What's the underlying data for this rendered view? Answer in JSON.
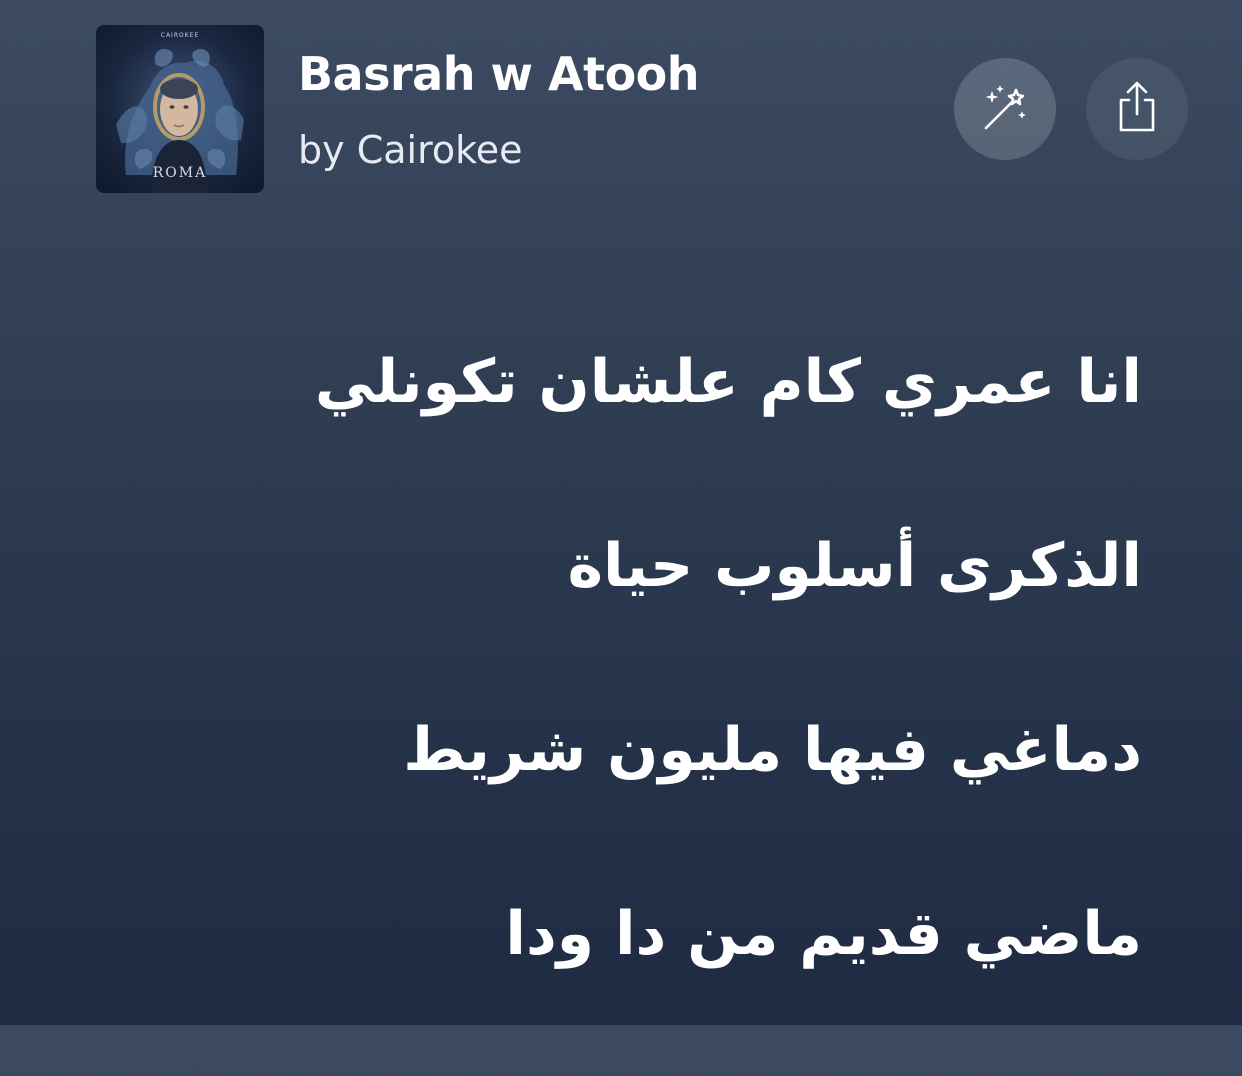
{
  "track": {
    "title": "Basrah w Atooh",
    "artist": "by Cairokee",
    "cover": {
      "top_text": "CAIROKEE",
      "bottom_text": "ROMA"
    }
  },
  "actions": {
    "magic_icon": "magic-wand-icon",
    "share_icon": "share-icon"
  },
  "lyrics": [
    "انا عمري كام علشان تكونلي",
    "الذكرى أسلوب حياة",
    "دماغي فيها مليون شريط",
    "ماضي قديم من دا ودا"
  ]
}
